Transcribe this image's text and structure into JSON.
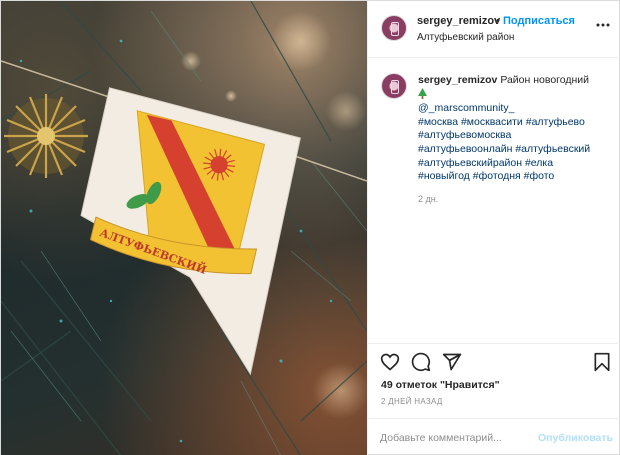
{
  "post": {
    "username": "sergey_remizov",
    "follow_label": "Подписаться",
    "location": "Алтуфьевский район"
  },
  "photo": {
    "emblem_text": "АЛТУФЬЕВСКИЙ"
  },
  "caption": {
    "username": "sergey_remizov",
    "text": "Район новогодний",
    "mention": "@_marscommunity_",
    "hashtags": [
      "#москва",
      "#москвасити",
      "#алтуфьево",
      "#алтуфьевомосква",
      "#алтуфьевоонлайн",
      "#алтуфьевский",
      "#алтуфьевскийрайон",
      "#елка",
      "#новыйгод",
      "#фотодня",
      "#фото"
    ],
    "time": "2 дн."
  },
  "actions": {
    "likes": "49 отметок \"Нравится\"",
    "ago": "2 ДНЕЙ НАЗАД"
  },
  "comment": {
    "placeholder": "Добавьте комментарий...",
    "publish_label": "Опубликовать"
  },
  "colors": {
    "link": "#0095f6",
    "hashtag": "#00376b",
    "muted": "#8e8e8e",
    "border": "#dbdbdb"
  }
}
